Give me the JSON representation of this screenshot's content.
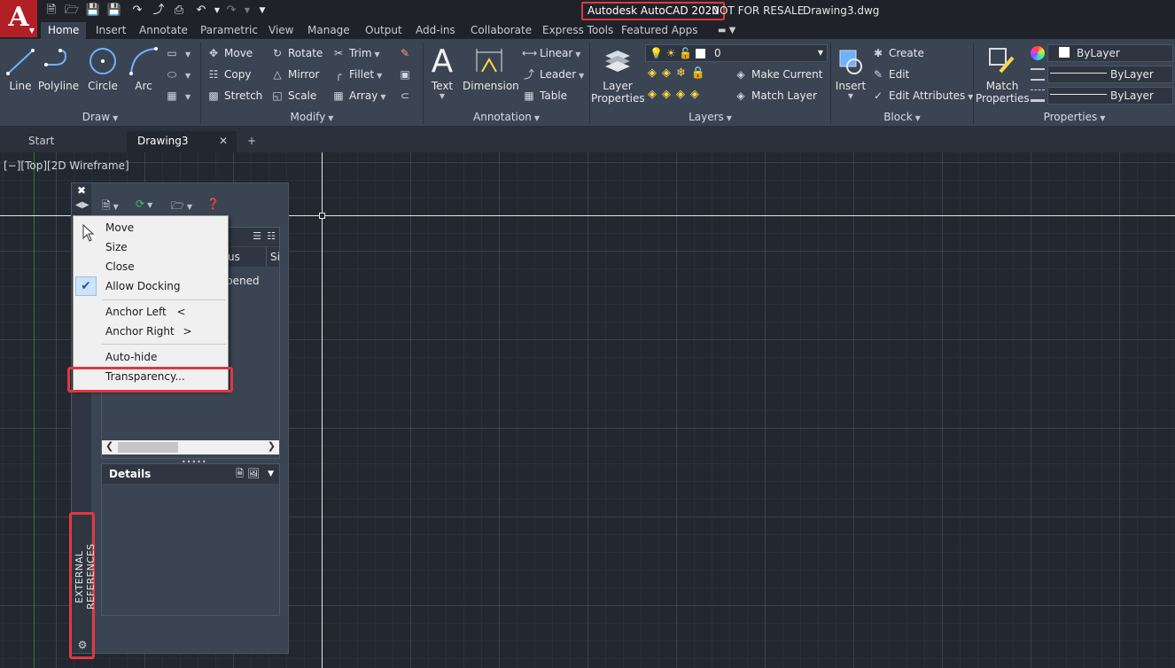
{
  "app": {
    "logo_letter": "A",
    "title_product": "Autodesk AutoCAD 2020",
    "title_notice": "NOT FOR RESALE",
    "title_file": "Drawing3.dwg"
  },
  "ribbon_tabs": [
    "Home",
    "Insert",
    "Annotate",
    "Parametric",
    "View",
    "Manage",
    "Output",
    "Add-ins",
    "Collaborate",
    "Express Tools",
    "Featured Apps"
  ],
  "draw_panel": {
    "title": "Draw",
    "tools": [
      "Line",
      "Polyline",
      "Circle",
      "Arc"
    ]
  },
  "modify_panel": {
    "title": "Modify",
    "tools": [
      "Move",
      "Rotate",
      "Trim",
      "Copy",
      "Mirror",
      "Fillet",
      "Stretch",
      "Scale",
      "Array"
    ]
  },
  "annotation_panel": {
    "title": "Annotation",
    "big_tools": [
      "Text",
      "Dimension"
    ],
    "small_tools": [
      "Linear",
      "Leader",
      "Table"
    ]
  },
  "layers_panel": {
    "title": "Layers",
    "big_tool_line1": "Layer",
    "big_tool_line2": "Properties",
    "current_layer": "0",
    "small_tools": [
      "Make Current",
      "Match Layer"
    ]
  },
  "block_panel": {
    "title": "Block",
    "big_tool": "Insert",
    "small_tools": [
      "Create",
      "Edit",
      "Edit Attributes"
    ]
  },
  "properties_panel": {
    "title": "Properties",
    "big_tool_line1": "Match",
    "big_tool_line2": "Properties",
    "color_value": "ByLayer",
    "linetype_value": "ByLayer",
    "lineweight_value": "ByLayer"
  },
  "file_tabs": [
    "Start",
    "Drawing3"
  ],
  "viewport": {
    "controls_label": "[−][Top][2D Wireframe]"
  },
  "palette": {
    "title": "EXTERNAL REFERENCES",
    "col_status_fragment": "us",
    "col_size_fragment": "Si",
    "row_status_fragment": "pened",
    "details_title": "Details"
  },
  "context_menu": {
    "items": [
      "Move",
      "Size",
      "Close",
      "Allow Docking",
      "Anchor Left",
      "Anchor Right",
      "Auto-hide",
      "Transparency..."
    ],
    "anchor_left_arrow": "<",
    "anchor_right_arrow": ">"
  },
  "colors": {
    "highlight": "#e0383e",
    "brand_red": "#b21f24",
    "ribbon_bg": "#3b4453",
    "viewport_bg": "#212830"
  }
}
